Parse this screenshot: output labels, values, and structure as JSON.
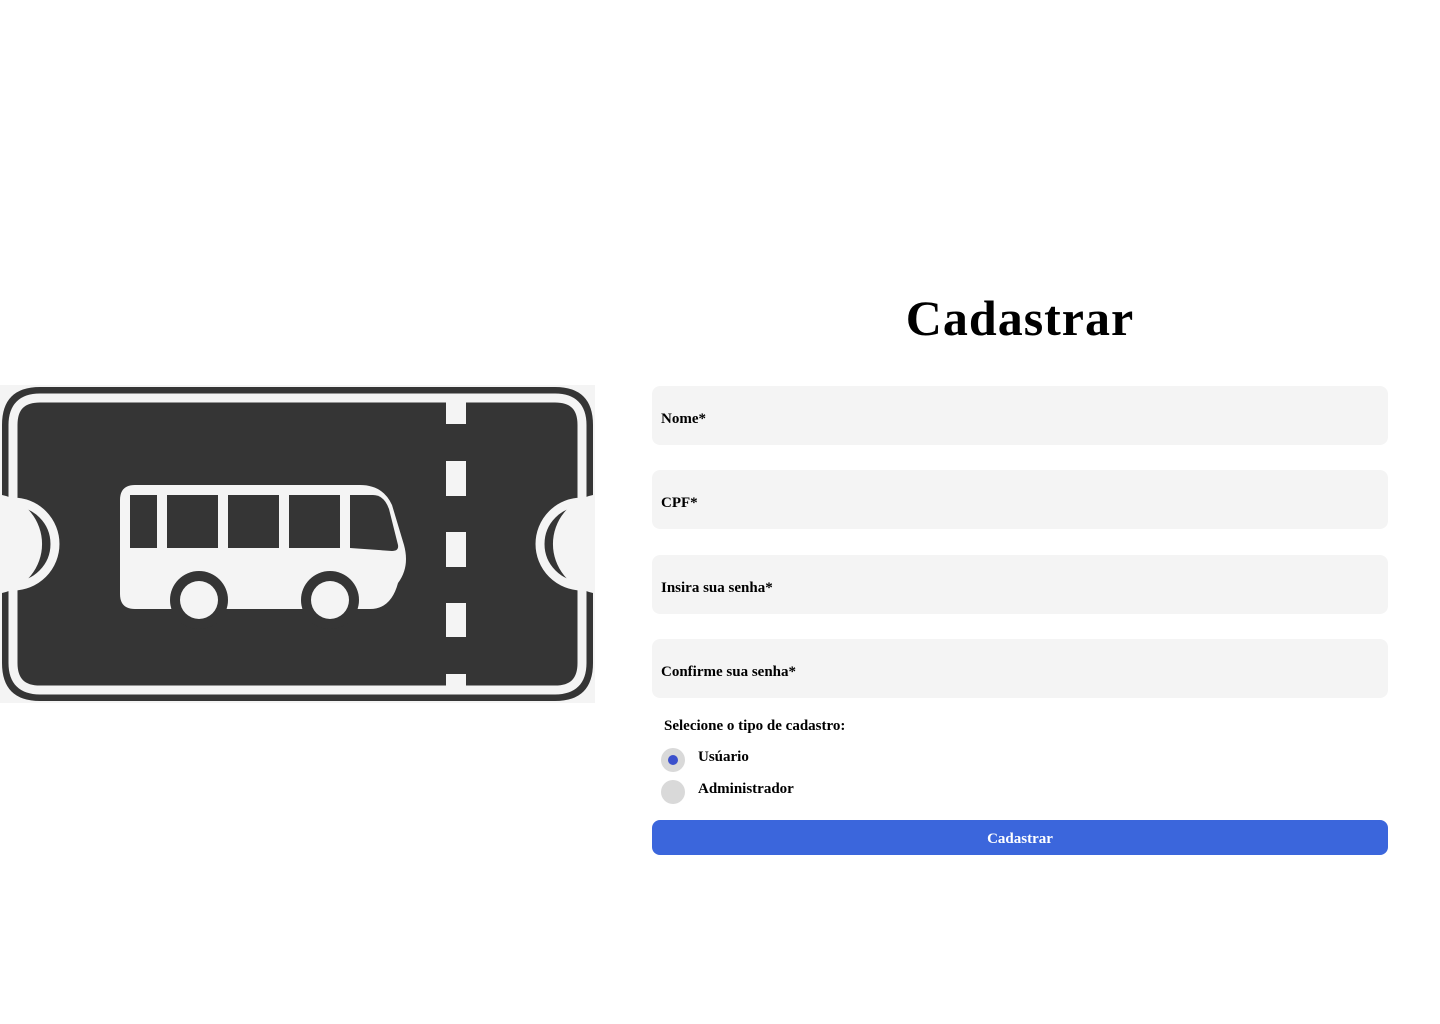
{
  "illustration": {
    "icon": "bus-ticket-icon"
  },
  "form": {
    "title": "Cadastrar",
    "fields": [
      {
        "label": "Nome*"
      },
      {
        "label": "CPF*"
      },
      {
        "label": "Insira sua senha*"
      },
      {
        "label": "Confirme sua senha*"
      }
    ],
    "account_type": {
      "label": "Selecione o tipo de cadastro:",
      "options": [
        {
          "label": "Usúario",
          "selected": true
        },
        {
          "label": "Administrador",
          "selected": false
        }
      ]
    },
    "submit_label": "Cadastrar"
  },
  "colors": {
    "ticket": "#353535",
    "field_bg": "#f4f4f4",
    "radio_bg": "#d9d9d9",
    "radio_dot": "#3b50cc",
    "button": "#3b66dc"
  }
}
